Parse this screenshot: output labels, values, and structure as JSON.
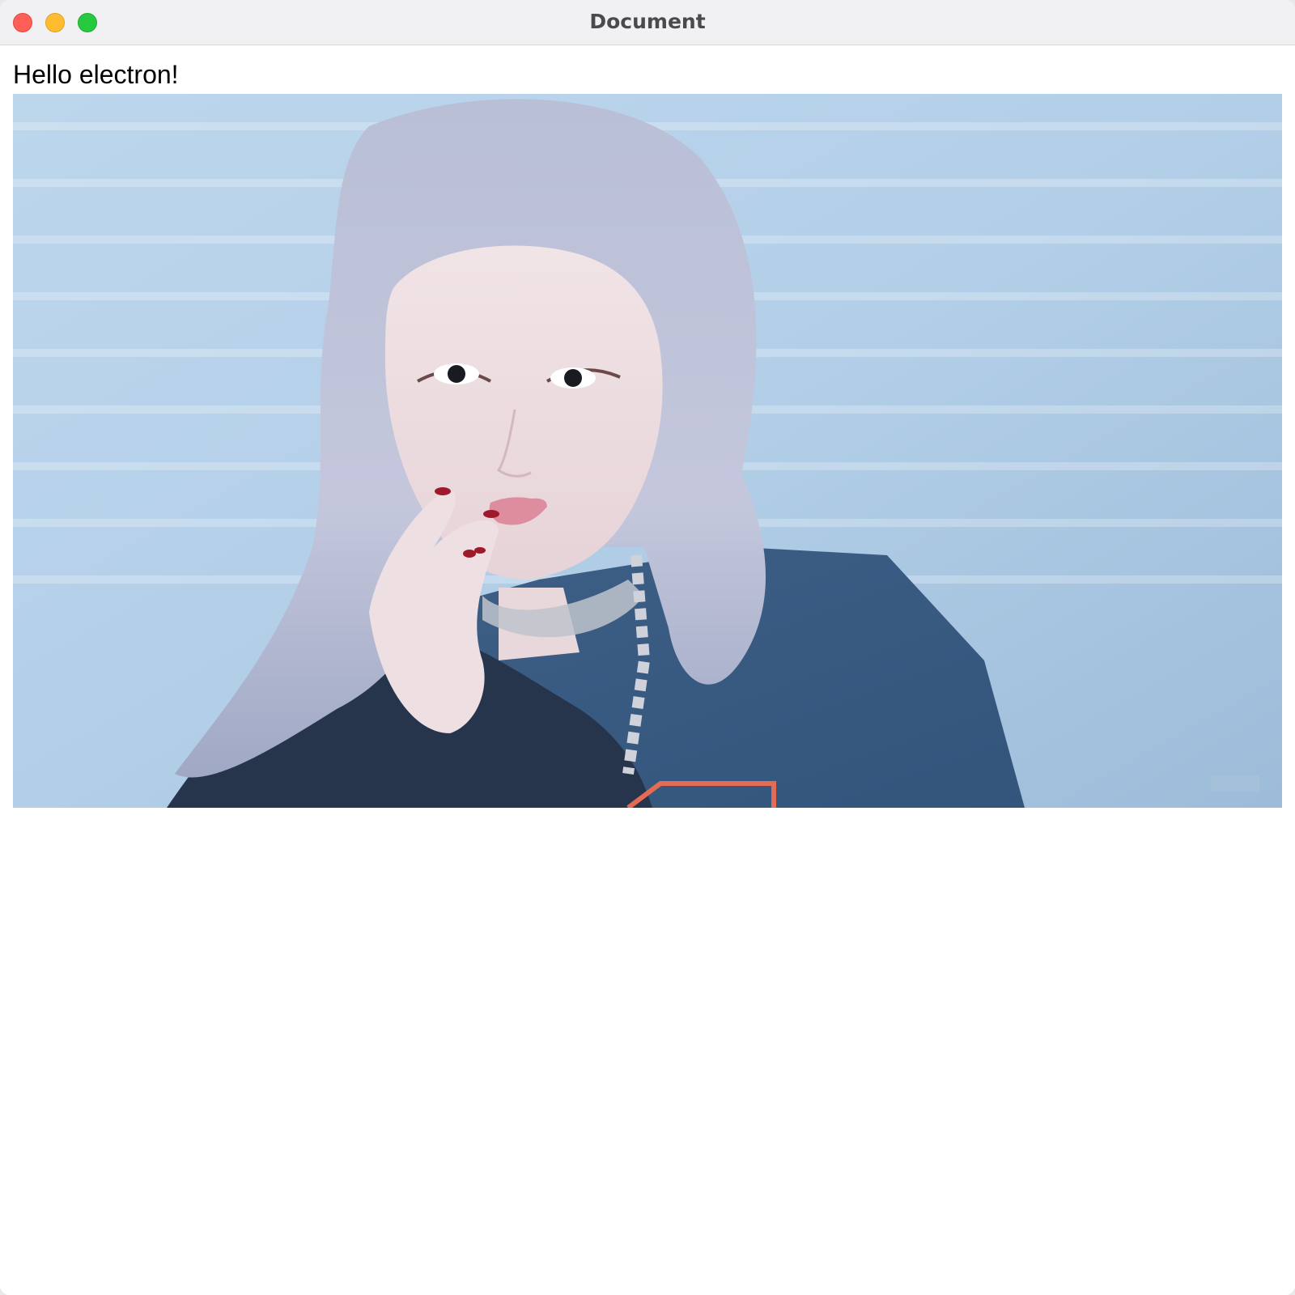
{
  "window": {
    "title": "Document",
    "controls": {
      "close_color": "#ff5f57",
      "minimize_color": "#febc2e",
      "zoom_color": "#28c840"
    }
  },
  "page": {
    "heading": "Hello electron!",
    "image": {
      "description_icon": "portrait-photo",
      "background_color": "#a9c6e0"
    }
  }
}
